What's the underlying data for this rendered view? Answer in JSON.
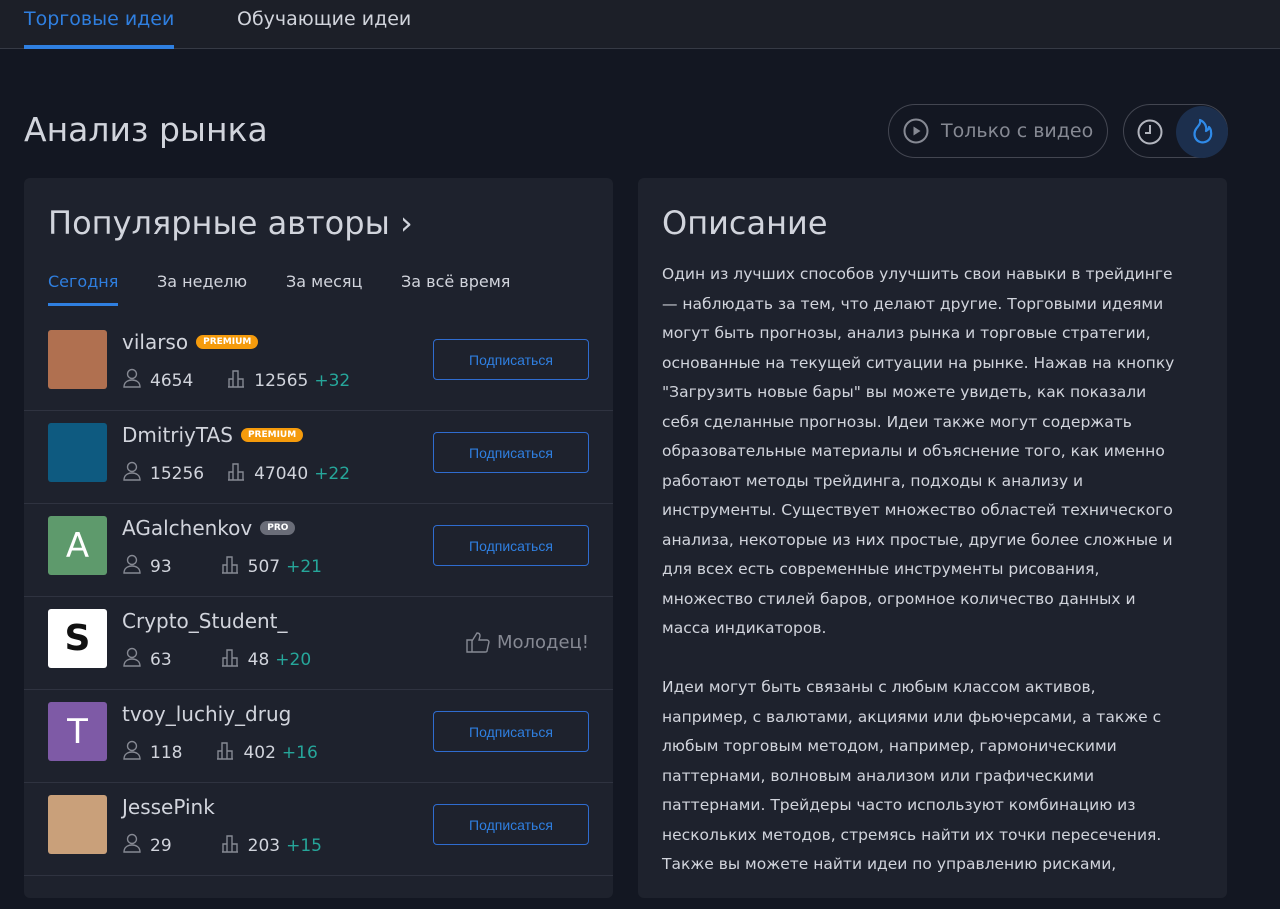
{
  "tabs": [
    {
      "label": "Торговые идеи",
      "active": true
    },
    {
      "label": "Обучающие идеи",
      "active": false
    }
  ],
  "page_title": "Анализ рынка",
  "video_filter": {
    "label": "Только с видео",
    "icon": "play-circle-icon"
  },
  "sort_toggle": {
    "options": [
      "clock-icon",
      "fire-icon"
    ],
    "active": "fire-icon"
  },
  "authors": {
    "title": "Популярные авторы ›",
    "periods": [
      {
        "label": "Сегодня",
        "active": true
      },
      {
        "label": "За неделю"
      },
      {
        "label": "За месяц"
      },
      {
        "label": "За всё время"
      }
    ],
    "subscribe_label": "Подписаться",
    "items": [
      {
        "name": "vilarso",
        "badge": "PREMIUM",
        "followers": "4654",
        "ideas": "12565",
        "delta": "+32",
        "avatar_color": "#b07050",
        "initial": ""
      },
      {
        "name": "DmitriyTAS",
        "badge": "PREMIUM",
        "followers": "15256",
        "ideas": "47040",
        "delta": "+22",
        "avatar_color": "#0e5a80",
        "initial": ""
      },
      {
        "name": "AGalchenkov",
        "badge": "PRO",
        "followers": "93",
        "ideas": "507",
        "delta": "+21",
        "avatar_color": "#5e9a6c",
        "initial": "A"
      },
      {
        "name": "Crypto_Student_",
        "badge": "",
        "followers": "63",
        "ideas": "48",
        "delta": "+20",
        "avatar_color": "#ffffff",
        "initial": "S",
        "action": "Молодец!"
      },
      {
        "name": "tvoy_luchiy_drug",
        "badge": "",
        "followers": "118",
        "ideas": "402",
        "delta": "+16",
        "avatar_color": "#7e5aa6",
        "initial": "T"
      },
      {
        "name": "JessePink",
        "badge": "",
        "followers": "29",
        "ideas": "203",
        "delta": "+15",
        "avatar_color": "#c9a07a",
        "initial": ""
      }
    ]
  },
  "colors": {
    "premium": "#f59b0c",
    "pro": "#6a6d78",
    "accent": "#2f7fe0",
    "positive": "#26a69a"
  },
  "description": {
    "title": "Описание",
    "paragraphs": [
      [
        "Один из лучших способов улучшить свои навыки в трейдинге",
        "— наблюдать за тем, что делают другие. Торговыми идеями",
        "могут быть прогнозы, анализ рынка и торговые стратегии,",
        "основанные на текущей ситуации на рынке. Нажав на кнопку",
        "\"Загрузить новые бары\" вы можете увидеть, как показали",
        "себя сделанные прогнозы. Идеи также могут содержать",
        "образовательные материалы и объяснение того, как именно",
        "работают методы трейдинга, подходы к анализу и",
        "инструменты. Существует множество областей технического",
        "анализа, некоторые из них простые, другие более сложные и",
        "для всех есть современные инструменты рисования,",
        "множество стилей баров, огромное количество данных и",
        "масса индикаторов."
      ],
      [
        "Идеи могут быть связаны с любым классом активов,",
        "например, с валютами, акциями или фьючерсами, а также с",
        "любым торговым методом, например, гармоническими",
        "паттернами, волновым анализом или графическими",
        "паттернами. Трейдеры часто используют комбинацию из",
        "нескольких методов, стремясь найти их точки пересечения.",
        "Также вы можете найти идеи по управлению рисками,"
      ]
    ]
  }
}
